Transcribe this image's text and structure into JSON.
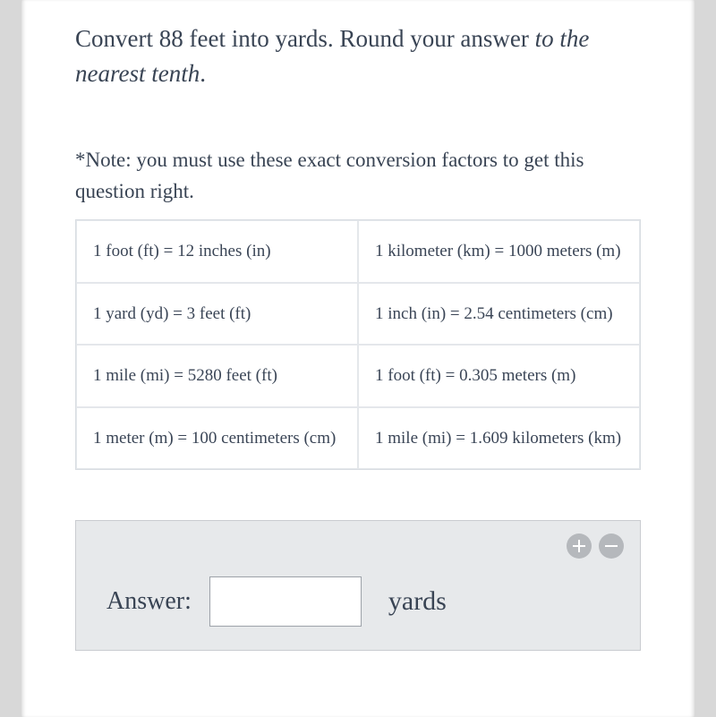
{
  "question": {
    "prefix": "Convert 88 feet into yards. Round your answer ",
    "italic": "to the nearest tenth",
    "suffix": "."
  },
  "note": "*Note: you must use these exact conversion factors to get this question right.",
  "table": {
    "r0c0": "1 foot (ft) = 12 inches (in)",
    "r0c1": "1 kilometer (km) = 1000 meters (m)",
    "r1c0": "1 yard (yd) = 3 feet (ft)",
    "r1c1": "1 inch (in) = 2.54 centimeters (cm)",
    "r2c0": "1 mile (mi) = 5280 feet (ft)",
    "r2c1": "1 foot (ft) = 0.305 meters (m)",
    "r3c0": "1 meter (m) = 100 centimeters (cm)",
    "r3c1": "1 mile (mi) = 1.609 kilometers (km)"
  },
  "answer": {
    "label": "Answer:",
    "value": "",
    "placeholder": "",
    "unit": "yards"
  }
}
